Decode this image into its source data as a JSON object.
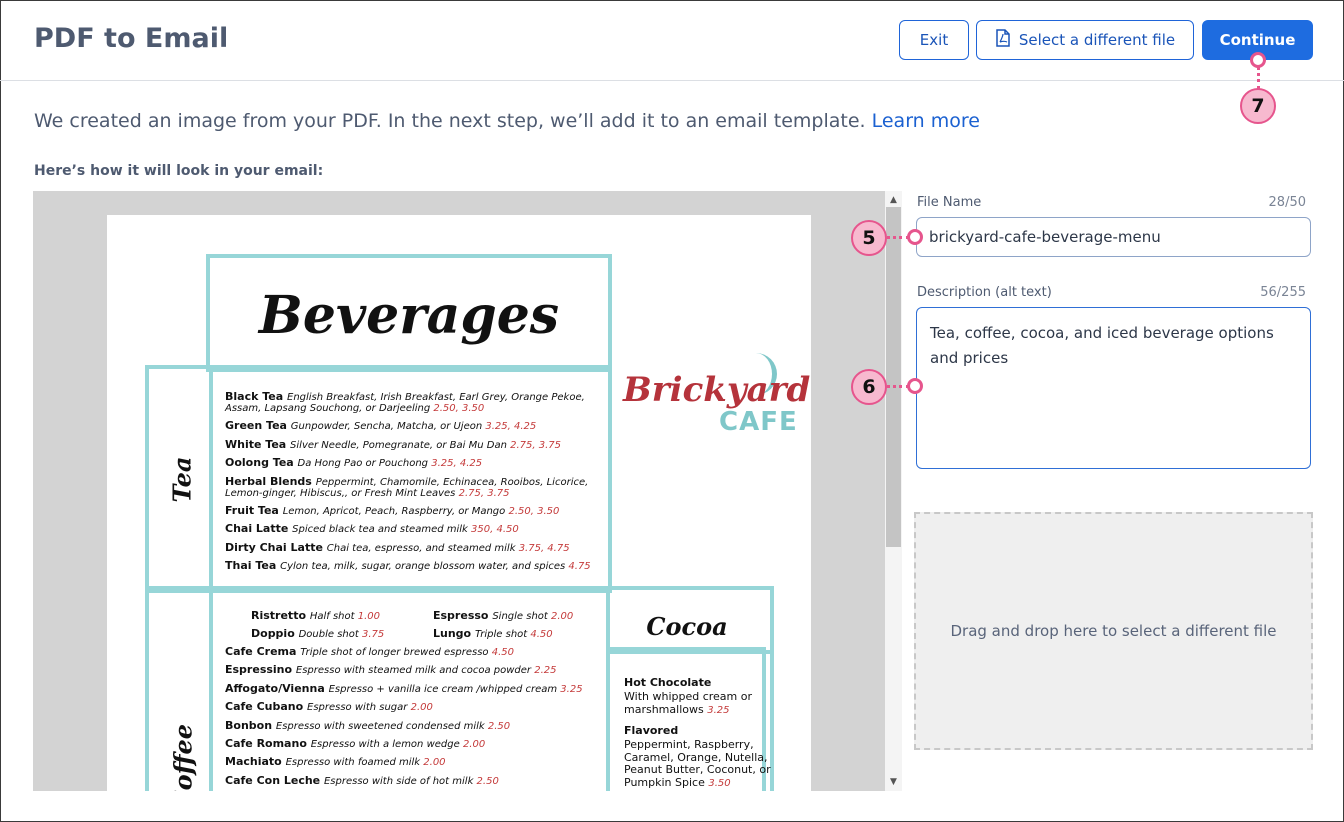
{
  "header": {
    "title": "PDF to Email",
    "exit_label": "Exit",
    "select_file_label": "Select a different file",
    "continue_label": "Continue"
  },
  "intro": {
    "text": "We created an image from your PDF. In the next step, we’ll add it to an email template.",
    "link_text": "Learn more"
  },
  "preview": {
    "label": "Here’s how it will look in your email:",
    "menu": {
      "title": "Beverages",
      "tea_heading": "Tea",
      "coffee_heading": "Coffee",
      "cocoa_heading": "Cocoa",
      "logo_top": "Brickyard",
      "logo_bottom": "CAFE",
      "tea_items": [
        {
          "name": "Black Tea",
          "desc": "English Breakfast, Irish Breakfast, Earl Grey, Orange Pekoe,",
          "desc2": "Assam, Lapsang Souchong, or Darjeeling",
          "price": "2.50, 3.50"
        },
        {
          "name": "Green Tea",
          "desc": "Gunpowder, Sencha, Matcha, or Ujeon",
          "price": "3.25, 4.25"
        },
        {
          "name": "White Tea",
          "desc": "Silver Needle, Pomegranate, or Bai Mu Dan",
          "price": "2.75, 3.75"
        },
        {
          "name": "Oolong Tea",
          "desc": "Da Hong Pao or Pouchong",
          "price": "3.25, 4.25"
        },
        {
          "name": "Herbal Blends",
          "desc": "Peppermint, Chamomile, Echinacea, Rooibos, Licorice,",
          "desc2": "Lemon-ginger, Hibiscus,, or Fresh Mint Leaves",
          "price": "2.75, 3.75"
        },
        {
          "name": "Fruit Tea",
          "desc": "Lemon, Apricot, Peach, Raspberry, or Mango",
          "price": "2.50, 3.50"
        },
        {
          "name": "Chai Latte",
          "desc": "Spiced black tea and steamed milk",
          "price": "350, 4.50"
        },
        {
          "name": "Dirty Chai Latte",
          "desc": "Chai tea, espresso, and steamed milk",
          "price": "3.75, 4.75"
        },
        {
          "name": "Thai Tea",
          "desc": "Cylon tea, milk, sugar, orange blossom water, and spices",
          "price": "4.75"
        }
      ],
      "coffee_pairs": [
        {
          "name": "Ristretto",
          "desc": "Half shot",
          "price": "1.00"
        },
        {
          "name": "Espresso",
          "desc": "Single shot",
          "price": "2.00"
        },
        {
          "name": "Doppio",
          "desc": "Double shot",
          "price": "3.75"
        },
        {
          "name": "Lungo",
          "desc": "Triple shot",
          "price": "4.50"
        }
      ],
      "coffee_items": [
        {
          "name": "Cafe Crema",
          "desc": "Triple shot  of longer brewed espresso",
          "price": "4.50"
        },
        {
          "name": "Espressino",
          "desc": "Espresso with steamed milk and cocoa powder",
          "price": "2.25"
        },
        {
          "name": "Affogato/Vienna",
          "desc": "Espresso + vanilla ice cream /whipped cream",
          "price": "3.25"
        },
        {
          "name": "Cafe Cubano",
          "desc": "Espresso with sugar",
          "price": "2.00"
        },
        {
          "name": "Bonbon",
          "desc": "Espresso with sweetened condensed milk",
          "price": "2.50"
        },
        {
          "name": "Cafe Romano",
          "desc": "Espresso with a lemon wedge",
          "price": "2.00"
        },
        {
          "name": "Machiato",
          "desc": "Espresso with foamed milk",
          "price": "2.00"
        },
        {
          "name": "Cafe Con Leche",
          "desc": "Espresso with side of hot milk",
          "price": "2.50"
        }
      ],
      "cocoa_items": [
        {
          "name": "Hot Chocolate",
          "lines": [
            "With whipped cream or",
            "marshmallows"
          ],
          "price": "3.25"
        },
        {
          "name": "Flavored",
          "lines": [
            "Peppermint, Raspberry,",
            "Caramel, Orange, Nutella,",
            "Peanut Butter, Coconut, or",
            "Pumpkin Spice"
          ],
          "price": "3.50"
        }
      ]
    }
  },
  "form": {
    "file_name_label": "File Name",
    "file_name_counter": "28/50",
    "file_name_value": "brickyard-cafe-beverage-menu",
    "description_label": "Description (alt text)",
    "description_counter": "56/255",
    "description_value": "Tea, coffee, cocoa, and iced beverage options and prices",
    "dropzone_text": "Drag and drop here to select a different file"
  },
  "callouts": {
    "five": "5",
    "six": "6",
    "seven": "7"
  },
  "colors": {
    "primary": "#1e6ce0",
    "callout_fill": "#f7b9cf",
    "callout_border": "#e6558d",
    "menu_border": "#97d6d8",
    "price_red": "#c43a3a"
  }
}
